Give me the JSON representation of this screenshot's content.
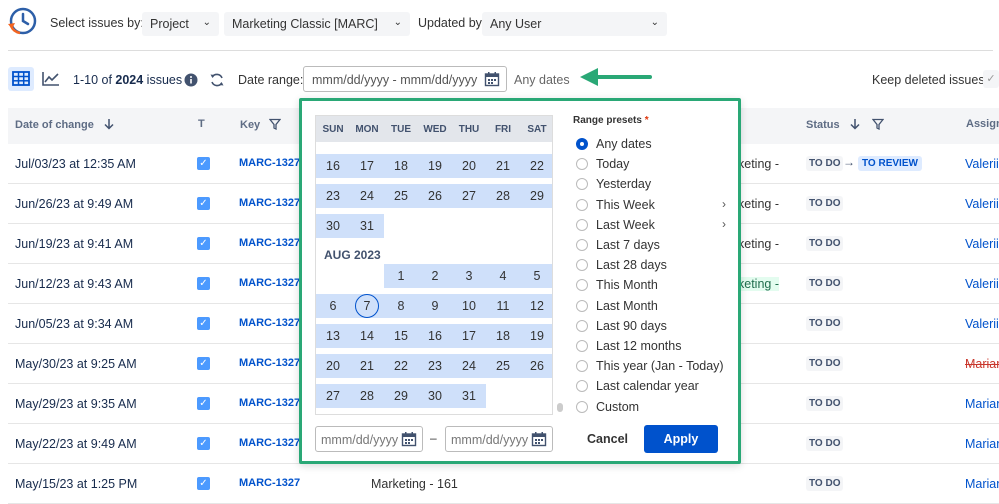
{
  "topbar": {
    "select_issues_label": "Select issues by:",
    "select_issues_value": "Project",
    "project_value": "Marketing Classic [MARC]",
    "updated_by_label": "Updated by:",
    "updated_by_value": "Any User"
  },
  "toolbar": {
    "count_range": "1-10 of ",
    "count_total": "2024",
    "count_suffix": " issues",
    "date_range_label": "Date range:",
    "date_range_placeholder": "mmm/dd/yyyy - mmm/dd/yyyy",
    "any_dates_text": "Any dates",
    "keep_deleted_label": "Keep deleted issues"
  },
  "table": {
    "headers": {
      "date_of_change": "Date of change",
      "type": "T",
      "key": "Key",
      "status": "Status",
      "assignee": "Assigne"
    },
    "rows": [
      {
        "date": "Jul/03/23 at 12:35 AM",
        "key": "MARC-1327",
        "summary": "keting -",
        "status": "TO DO",
        "status_to": "TO REVIEW",
        "assignee": "Valerii"
      },
      {
        "date": "Jun/26/23 at 9:49 AM",
        "key": "MARC-1327",
        "summary": "keting -",
        "status": "TO DO",
        "assignee": "Valerii"
      },
      {
        "date": "Jun/19/23 at 9:41 AM",
        "key": "MARC-1327",
        "summary": "keting -",
        "status": "TO DO",
        "assignee": "Valerii"
      },
      {
        "date": "Jun/12/23 at 9:43 AM",
        "key": "MARC-1327",
        "summary": "keting -",
        "status": "TO DO",
        "assignee": "Valerii"
      },
      {
        "date": "Jun/05/23 at 9:34 AM",
        "key": "MARC-1327",
        "summary": "",
        "status": "TO DO",
        "assignee": "Valerii"
      },
      {
        "date": "May/30/23 at 9:25 AM",
        "key": "MARC-1327",
        "summary": "",
        "status": "TO DO",
        "assignee": "Marian"
      },
      {
        "date": "May/29/23 at 9:35 AM",
        "key": "MARC-1327",
        "summary": "",
        "status": "TO DO",
        "assignee": "Marian"
      },
      {
        "date": "May/22/23 at 9:49 AM",
        "key": "MARC-1327",
        "summary": "",
        "status": "TO DO",
        "assignee": "Marian"
      },
      {
        "date": "May/15/23 at 1:25 PM",
        "key": "MARC-1327",
        "summary": "Marketing - 161",
        "status": "TO DO",
        "assignee": "Marian"
      }
    ]
  },
  "calendar": {
    "weekdays": [
      "SUN",
      "MON",
      "TUE",
      "WED",
      "THU",
      "FRI",
      "SAT"
    ],
    "july_rows": [
      [
        "16",
        "17",
        "18",
        "19",
        "20",
        "21",
        "22"
      ],
      [
        "23",
        "24",
        "25",
        "26",
        "27",
        "28",
        "29"
      ],
      [
        "30",
        "31"
      ]
    ],
    "month_label": "AUG 2023",
    "aug_rows": [
      [
        "",
        "",
        "1",
        "2",
        "3",
        "4",
        "5"
      ],
      [
        "6",
        "7",
        "8",
        "9",
        "10",
        "11",
        "12"
      ],
      [
        "13",
        "14",
        "15",
        "16",
        "17",
        "18",
        "19"
      ],
      [
        "20",
        "21",
        "22",
        "23",
        "24",
        "25",
        "26"
      ],
      [
        "27",
        "28",
        "29",
        "30",
        "31"
      ]
    ],
    "today": "7"
  },
  "presets": {
    "title": "Range presets",
    "required_mark": "*",
    "items": [
      {
        "label": "Any dates",
        "selected": true,
        "submenu": false
      },
      {
        "label": "Today",
        "selected": false,
        "submenu": false
      },
      {
        "label": "Yesterday",
        "selected": false,
        "submenu": false
      },
      {
        "label": "This Week",
        "selected": false,
        "submenu": true
      },
      {
        "label": "Last Week",
        "selected": false,
        "submenu": true
      },
      {
        "label": "Last 7 days",
        "selected": false,
        "submenu": false
      },
      {
        "label": "Last 28 days",
        "selected": false,
        "submenu": false
      },
      {
        "label": "This Month",
        "selected": false,
        "submenu": false
      },
      {
        "label": "Last Month",
        "selected": false,
        "submenu": false
      },
      {
        "label": "Last 90 days",
        "selected": false,
        "submenu": false
      },
      {
        "label": "Last 12 months",
        "selected": false,
        "submenu": false
      },
      {
        "label": "This year (Jan - Today)",
        "selected": false,
        "submenu": false
      },
      {
        "label": "Last calendar year",
        "selected": false,
        "submenu": false
      },
      {
        "label": "Custom",
        "selected": false,
        "submenu": false
      }
    ]
  },
  "popup_footer": {
    "from_placeholder": "mmm/dd/yyyy",
    "to_placeholder": "mmm/dd/yyyy",
    "dash": "–",
    "cancel_label": "Cancel",
    "apply_label": "Apply"
  },
  "colors": {
    "accent": "#0052cc",
    "highlight_border": "#2aa876",
    "range_band": "#cfe0fa"
  }
}
